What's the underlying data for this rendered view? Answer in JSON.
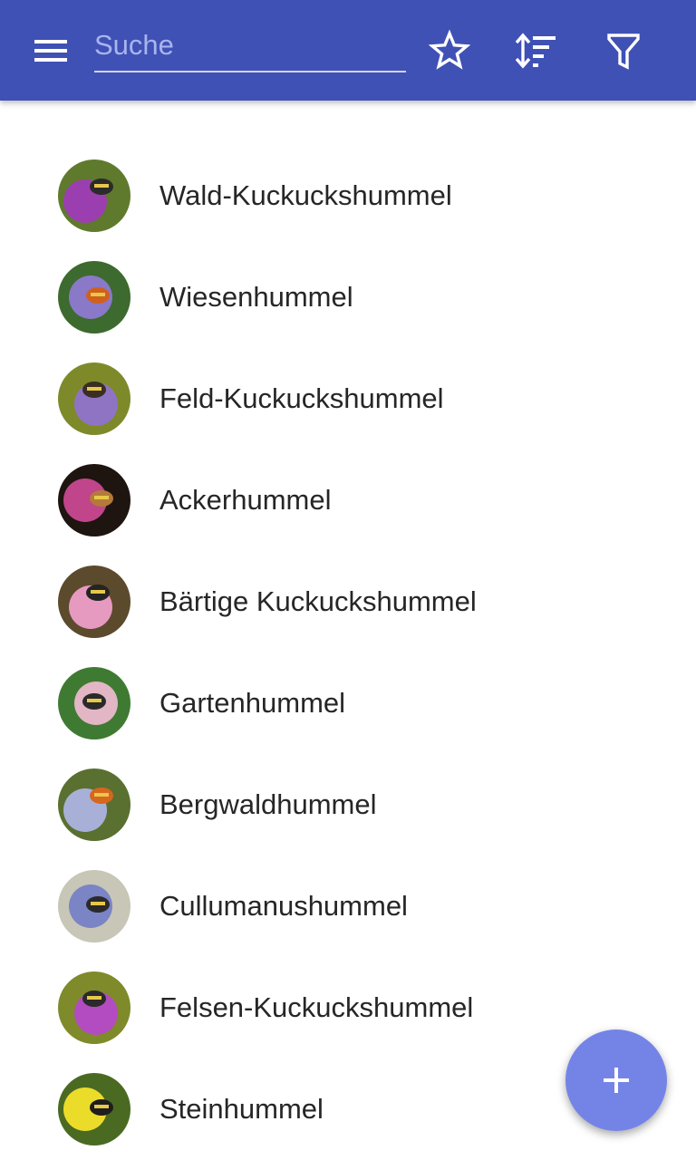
{
  "toolbar": {
    "background": "#3f51b5",
    "menu_icon": "menu-icon",
    "search": {
      "placeholder": "Suche",
      "value": ""
    },
    "actions": [
      "star-icon",
      "sort-icon",
      "filter-icon"
    ]
  },
  "list": {
    "items": [
      {
        "label": "Wald-Kuckuckshummel",
        "avatar_colors": [
          "#5f7a2c",
          "#9b3fb0",
          "#2b2b2b"
        ]
      },
      {
        "label": "Wiesenhummel",
        "avatar_colors": [
          "#3d6a2e",
          "#8a78c8",
          "#d0601c"
        ]
      },
      {
        "label": "Feld-Kuckuckshummel",
        "avatar_colors": [
          "#7e8a2a",
          "#8f74c4",
          "#3a2e22"
        ]
      },
      {
        "label": "Ackerhummel",
        "avatar_colors": [
          "#1e1410",
          "#c0458a",
          "#b47a3a"
        ]
      },
      {
        "label": "Bärtige Kuckuckshummel",
        "avatar_colors": [
          "#5c4a2c",
          "#e79ac0",
          "#242424"
        ]
      },
      {
        "label": "Gartenhummel",
        "avatar_colors": [
          "#3f7a32",
          "#e2b6c4",
          "#2a2a2a"
        ]
      },
      {
        "label": "Bergwaldhummel",
        "avatar_colors": [
          "#5a7030",
          "#a8b0d8",
          "#d7661e"
        ]
      },
      {
        "label": "Cullumanushummel",
        "avatar_colors": [
          "#c8c6b6",
          "#7b84c4",
          "#2a2a2a"
        ]
      },
      {
        "label": "Felsen-Kuckuckshummel",
        "avatar_colors": [
          "#7f8a2a",
          "#b24cc0",
          "#2a2a2a"
        ]
      },
      {
        "label": "Steinhummel",
        "avatar_colors": [
          "#4a6a22",
          "#ecdc2a",
          "#1e1e1e"
        ]
      }
    ]
  },
  "fab": {
    "icon": "plus-icon",
    "color": "#7484e6"
  }
}
